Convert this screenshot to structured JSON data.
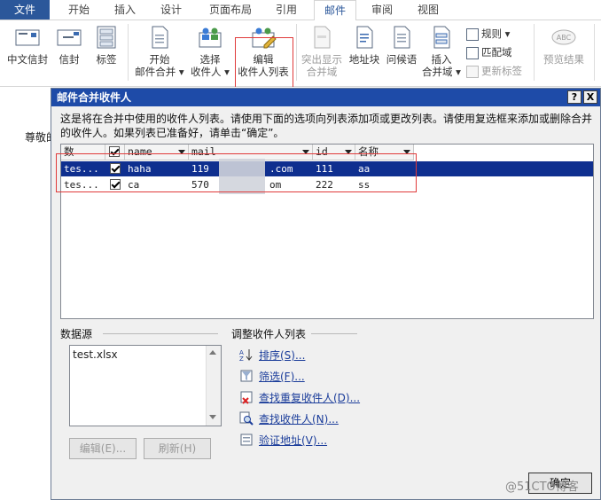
{
  "tabs": [
    "文件",
    "开始",
    "插入",
    "设计",
    "页面布局",
    "引用",
    "邮件",
    "审阅",
    "视图"
  ],
  "ribbon": {
    "btn_chinese_envelope": "中文信封",
    "btn_envelope": "信封",
    "btn_labels": "标签",
    "btn_start_merge_1": "开始",
    "btn_start_merge_2": "邮件合并 ▾",
    "btn_select_recipients_1": "选择",
    "btn_select_recipients_2": "收件人 ▾",
    "btn_edit_recipients_1": "编辑",
    "btn_edit_recipients_2": "收件人列表",
    "btn_highlight_1": "突出显示",
    "btn_highlight_2": "合并域",
    "btn_address_block": "地址块",
    "btn_greeting": "问候语",
    "btn_insert_field_1": "插入",
    "btn_insert_field_2": "合并域 ▾",
    "rules": "规则 ▾",
    "match_fields": "匹配域",
    "update_labels": "更新标签",
    "btn_preview": "预览结果"
  },
  "doc": {
    "salutation": "尊敬的"
  },
  "dialog": {
    "title": "邮件合并收件人",
    "help_btn": "?",
    "close_btn": "X",
    "description": "这是将在合并中使用的收件人列表。请使用下面的选项向列表添加项或更改列表。请使用复选框来添加或删除合并的收件人。如果列表已准备好，请单击“确定”。",
    "columns": [
      "数",
      "",
      "name",
      "mail",
      "id",
      "名称"
    ],
    "rows": [
      {
        "src": "tes...",
        "name": "haha",
        "mail_a": "119",
        "mail_b": ".com",
        "id": "111",
        "mingcheng": "aa"
      },
      {
        "src": "tes...",
        "name": "ca",
        "mail_a": "570",
        "mail_b": "om",
        "id": "222",
        "mingcheng": "ss"
      }
    ],
    "datasource_label": "数据源",
    "datasource_item": "test.xlsx",
    "adjust_label": "调整收件人列表",
    "edit_btn": "编辑(E)...",
    "refresh_btn": "刷新(H)",
    "links": [
      "排序(S)...",
      "筛选(F)...",
      "查找重复收件人(D)...",
      "查找收件人(N)...",
      "验证地址(V)..."
    ],
    "ok_btn": "确定"
  },
  "watermark": "@51CTO博客",
  "colors": {
    "file_tab": "#2b579a",
    "title_bar": "#1e4ba8",
    "selection": "#0f2f8f",
    "highlight_box": "#e03a3a",
    "link": "#1a3c9a"
  }
}
